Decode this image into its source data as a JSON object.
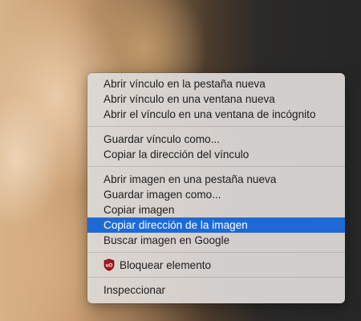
{
  "context_menu": {
    "groups": [
      {
        "items": [
          {
            "label": "Abrir vínculo en la pestaña nueva"
          },
          {
            "label": "Abrir vínculo en una ventana nueva"
          },
          {
            "label": "Abrir el vínculo en una ventana de incógnito"
          }
        ]
      },
      {
        "items": [
          {
            "label": "Guardar vínculo como..."
          },
          {
            "label": "Copiar la dirección del vínculo"
          }
        ]
      },
      {
        "items": [
          {
            "label": "Abrir imagen en una pestaña nueva"
          },
          {
            "label": "Guardar imagen como..."
          },
          {
            "label": "Copiar imagen"
          },
          {
            "label": "Copiar dirección de la imagen",
            "highlighted": true
          },
          {
            "label": "Buscar imagen en Google"
          }
        ]
      },
      {
        "items": [
          {
            "label": "Bloquear elemento",
            "icon": "ublock-origin-shield-icon"
          }
        ]
      },
      {
        "items": [
          {
            "label": "Inspeccionar"
          }
        ]
      }
    ],
    "highlight_color": "#1d6ad7"
  }
}
